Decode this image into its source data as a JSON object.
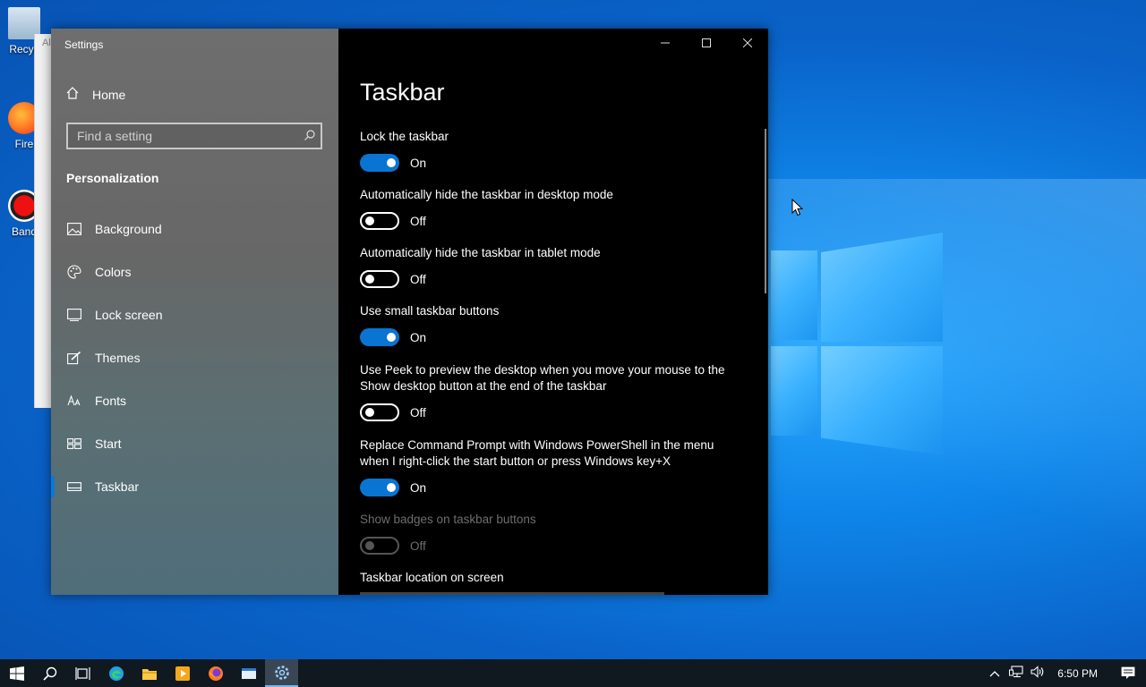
{
  "desktop": {
    "icons": [
      {
        "label": "Recycle Bin",
        "visible_label": "Recyc"
      },
      {
        "label": "Firefox",
        "visible_label": "Fire"
      },
      {
        "label": "Bandicam",
        "visible_label": "Band"
      }
    ],
    "back_window_fragment": "Al"
  },
  "window": {
    "title": "Settings",
    "controls": {
      "minimize": "—",
      "maximize": "☐",
      "close": "✕"
    }
  },
  "sidebar": {
    "home_label": "Home",
    "search_placeholder": "Find a setting",
    "section": "Personalization",
    "items": [
      {
        "label": "Background",
        "icon": "image-icon"
      },
      {
        "label": "Colors",
        "icon": "palette-icon"
      },
      {
        "label": "Lock screen",
        "icon": "lock-screen-icon"
      },
      {
        "label": "Themes",
        "icon": "themes-icon"
      },
      {
        "label": "Fonts",
        "icon": "fonts-icon"
      },
      {
        "label": "Start",
        "icon": "start-icon"
      },
      {
        "label": "Taskbar",
        "icon": "taskbar-icon",
        "active": true
      }
    ]
  },
  "main": {
    "title": "Taskbar",
    "settings": [
      {
        "label": "Lock the taskbar",
        "state": "On"
      },
      {
        "label": "Automatically hide the taskbar in desktop mode",
        "state": "Off"
      },
      {
        "label": "Automatically hide the taskbar in tablet mode",
        "state": "Off"
      },
      {
        "label": "Use small taskbar buttons",
        "state": "On"
      },
      {
        "label": "Use Peek to preview the desktop when you move your mouse to the Show desktop button at the end of the taskbar",
        "state": "Off"
      },
      {
        "label": "Replace Command Prompt with Windows PowerShell in the menu when I right-click the start button or press Windows key+X",
        "state": "On"
      },
      {
        "label": "Show badges on taskbar buttons",
        "state": "Off",
        "disabled": true
      }
    ],
    "location_label": "Taskbar location on screen"
  },
  "taskbar": {
    "clock": "6:50 PM",
    "apps": [
      "windows-start-icon",
      "search-icon",
      "task-view-icon",
      "edge-icon",
      "file-explorer-icon",
      "media-player-icon",
      "firefox-icon",
      "window-app-icon",
      "settings-icon"
    ]
  },
  "colors": {
    "accent": "#0a74d2",
    "taskbar": "#101820"
  }
}
